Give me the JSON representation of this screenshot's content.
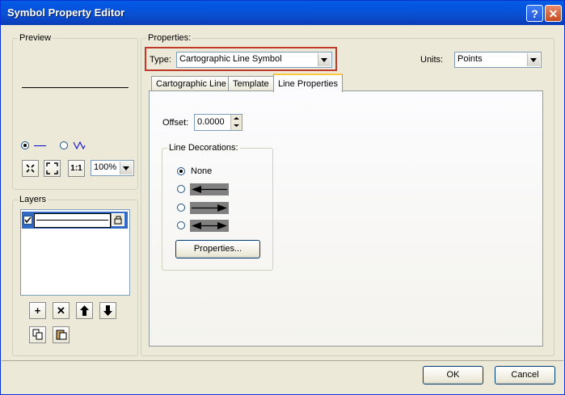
{
  "window": {
    "title": "Symbol Property Editor",
    "help_glyph": "?",
    "close_glyph": "✕"
  },
  "preview": {
    "group_label": "Preview",
    "zoom_value": "100%",
    "zoom_icons": [
      "zoom-in-icon",
      "zoom-to-fit-icon",
      "actual-size-icon"
    ],
    "actual_size_text": "1:1",
    "radio_line_selected": true
  },
  "layers": {
    "group_label": "Layers",
    "add_glyph": "+",
    "delete_glyph": "✕",
    "up_glyph": "🡅",
    "down_glyph": "🡇"
  },
  "properties": {
    "group_label": "Properties:",
    "type_label": "Type:",
    "type_value": "Cartographic Line Symbol",
    "units_label": "Units:",
    "units_value": "Points",
    "tabs": [
      {
        "label": "Cartographic Line"
      },
      {
        "label": "Template"
      },
      {
        "label": "Line Properties",
        "active": true
      }
    ],
    "offset_label": "Offset:",
    "offset_value": "0.0000",
    "line_decorations": {
      "group_label": "Line Decorations:",
      "none_label": "None",
      "selected": "None",
      "options": [
        "none",
        "arrow-left",
        "arrow-right",
        "arrow-both"
      ]
    },
    "properties_button": "Properties..."
  },
  "footer": {
    "ok": "OK",
    "cancel": "Cancel"
  },
  "colors": {
    "titlebar": "#0a5fd8",
    "highlight_border": "#c0392b",
    "selection": "#316ac5",
    "face": "#ece9d8"
  }
}
